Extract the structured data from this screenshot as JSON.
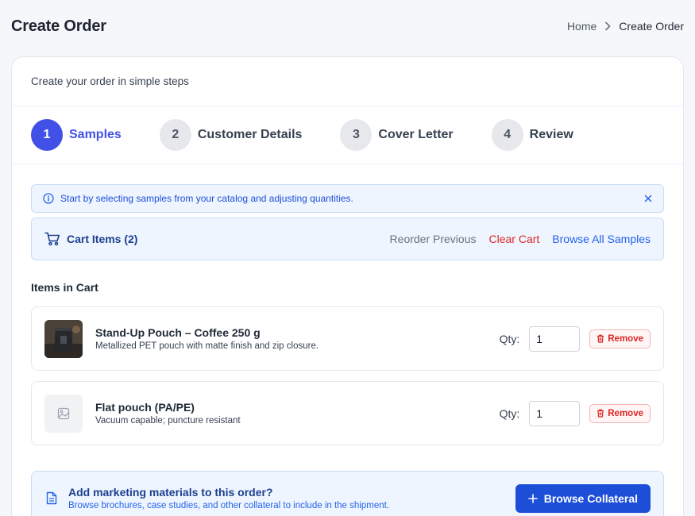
{
  "page": {
    "title": "Create Order",
    "breadcrumb": {
      "home": "Home",
      "current": "Create Order"
    }
  },
  "card": {
    "subtitle": "Create your order in simple steps",
    "steps": [
      {
        "num": "1",
        "label": "Samples",
        "active": true
      },
      {
        "num": "2",
        "label": "Customer Details",
        "active": false
      },
      {
        "num": "3",
        "label": "Cover Letter",
        "active": false
      },
      {
        "num": "4",
        "label": "Review",
        "active": false
      }
    ],
    "alert": {
      "text": "Start by selecting samples from your catalog and adjusting quantities."
    },
    "cart_bar": {
      "title": "Cart Items (2)",
      "reorder": "Reorder Previous",
      "clear": "Clear Cart",
      "browse": "Browse All Samples"
    },
    "items_title": "Items in Cart",
    "items": [
      {
        "name": "Stand-Up Pouch – Coffee 250 g",
        "desc": "Metallized PET pouch with matte finish and zip closure.",
        "qty_label": "Qty:",
        "qty": "1",
        "remove": "Remove"
      },
      {
        "name": "Flat pouch (PA/PE)",
        "desc": "Vacuum capable; puncture resistant",
        "qty_label": "Qty:",
        "qty": "1",
        "remove": "Remove"
      }
    ],
    "marketing": {
      "title": "Add marketing materials to this order?",
      "subtitle": "Browse brochures, case studies, and other collateral to include in the shipment.",
      "button": "Browse Collateral"
    }
  },
  "colors": {
    "accent": "#4151e8",
    "link": "#2563eb",
    "danger": "#dc2626",
    "info_bg": "#eef5ff",
    "primary_button": "#1d4ed8"
  }
}
